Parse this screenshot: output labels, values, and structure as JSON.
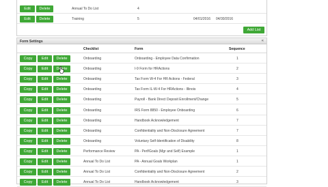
{
  "top_table": {
    "rows": [
      {
        "buttons": [
          "Edit",
          "Delete"
        ],
        "name": "Annual To Do List",
        "sequence": "4",
        "start": "",
        "end": ""
      },
      {
        "buttons": [
          "Edit",
          "Delete"
        ],
        "name": "Training",
        "sequence": "5",
        "start": "04/01/2016",
        "end": "04/30/2016"
      }
    ],
    "add_button": "Add List"
  },
  "form_settings": {
    "title": "Form Settings",
    "collapse_glyph": "«",
    "columns": {
      "checklist": "Checklist",
      "form": "Form",
      "sequence": "Sequence"
    },
    "button_labels": {
      "copy": "Copy",
      "edit": "Edit",
      "delete": "Delete"
    },
    "rows": [
      {
        "checklist": "Onboarding",
        "form": "Onboarding - Employee Data Confirmation",
        "sequence": "1"
      },
      {
        "checklist": "Onboarding",
        "form": "I-9 Form for HRActions",
        "sequence": "2"
      },
      {
        "checklist": "Onboarding",
        "form": "Tax Form W-4 For HR Actions - Federal",
        "sequence": "3"
      },
      {
        "checklist": "Onboarding",
        "form": "Tax Form IL-W-4 For HRActions - Illinois",
        "sequence": "4"
      },
      {
        "checklist": "Onboarding",
        "form": "Payroll - Bank Direct Deposit Enrollment/Change",
        "sequence": "5"
      },
      {
        "checklist": "Onboarding",
        "form": "IRS Form 8850 - Employee Onboarding",
        "sequence": "6"
      },
      {
        "checklist": "Onboarding",
        "form": "Handbook Acknowledgement",
        "sequence": "7"
      },
      {
        "checklist": "Onboarding",
        "form": "Confidentiality and Non-Disclosure Agreement",
        "sequence": "7"
      },
      {
        "checklist": "Onboarding",
        "form": "Voluntary Self-Identification of Disability",
        "sequence": "8"
      },
      {
        "checklist": "Performance Review",
        "form": "PA - Perf/Goals (Mgr and Self) Example",
        "sequence": "1"
      },
      {
        "checklist": "Annual To Do List",
        "form": "PA - Annual Goals Workplan",
        "sequence": "1"
      },
      {
        "checklist": "Annual To Do List",
        "form": "Confidentiality and Non-Disclosure Agreement",
        "sequence": "2"
      },
      {
        "checklist": "Annual To Do List",
        "form": "Handbook Acknowledgement",
        "sequence": "3"
      }
    ]
  },
  "colors": {
    "button_green": "#3fa836",
    "panel_border": "#d0d0d0"
  }
}
